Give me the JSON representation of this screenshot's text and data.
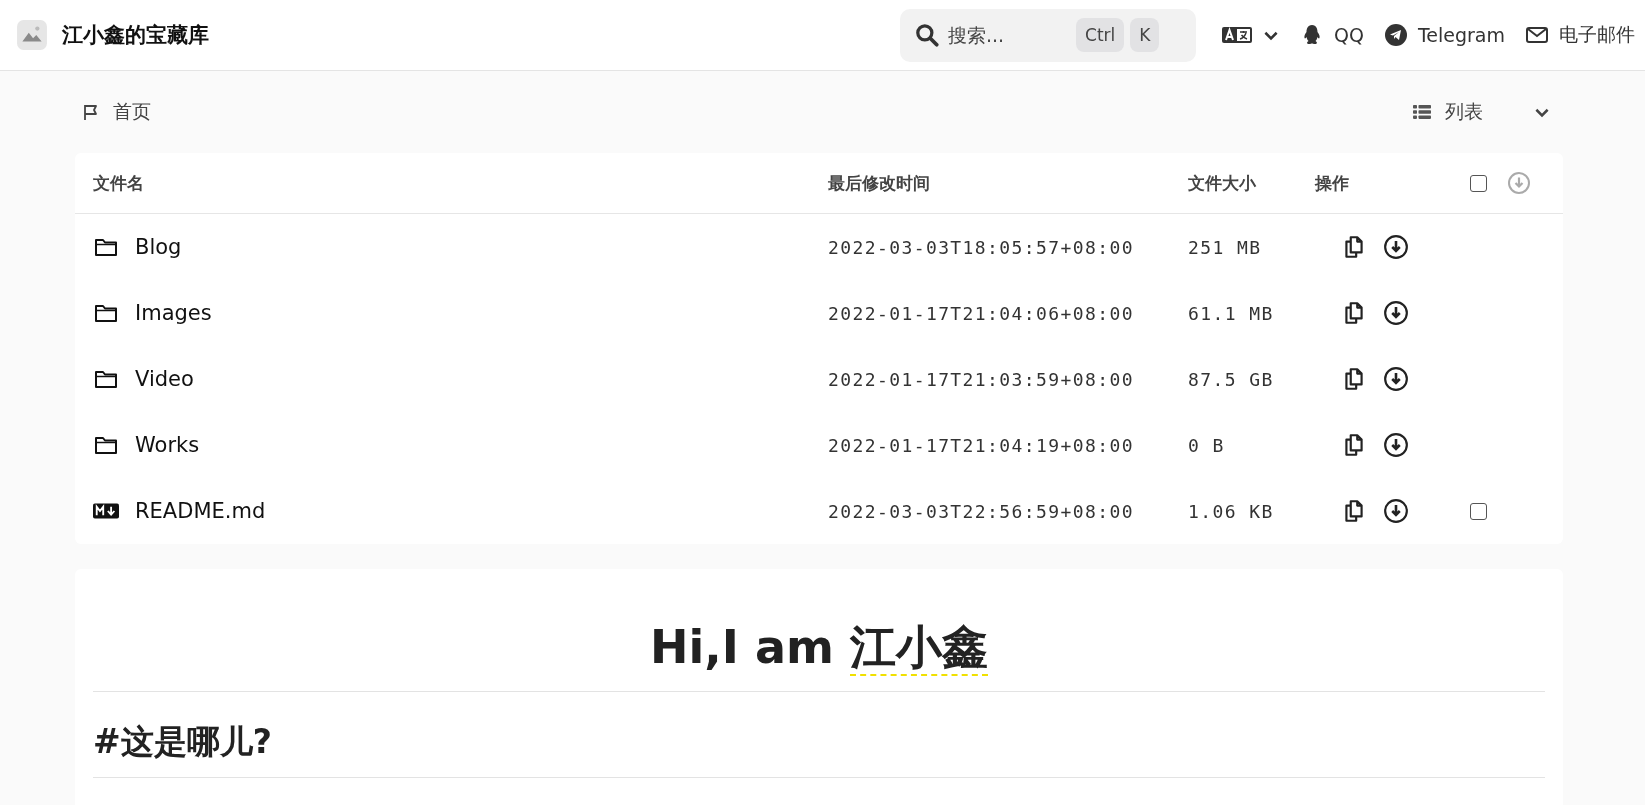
{
  "header": {
    "site_title": "江小鑫的宝藏库",
    "search": {
      "placeholder": "搜索...",
      "keys": [
        "Ctrl",
        "K"
      ]
    },
    "links": [
      {
        "kind": "qq",
        "label": "QQ"
      },
      {
        "kind": "telegram",
        "label": "Telegram"
      },
      {
        "kind": "email",
        "label": "电子邮件"
      }
    ]
  },
  "breadcrumb": {
    "label": "首页"
  },
  "view_switch": {
    "label": "列表",
    "expanded": false
  },
  "table": {
    "columns": [
      "文件名",
      "最后修改时间",
      "文件大小",
      "操作"
    ],
    "select_all": {
      "checked": false
    },
    "rows": [
      {
        "kind": "folder",
        "name": "Blog",
        "modified": "2022-03-03T18:05:57+08:00",
        "size": "251 MB"
      },
      {
        "kind": "folder",
        "name": "Images",
        "modified": "2022-01-17T21:04:06+08:00",
        "size": "61.1 MB"
      },
      {
        "kind": "folder",
        "name": "Video",
        "modified": "2022-01-17T21:03:59+08:00",
        "size": "87.5 GB"
      },
      {
        "kind": "folder",
        "name": "Works",
        "modified": "2022-01-17T21:04:19+08:00",
        "size": "0 B"
      },
      {
        "kind": "markdown",
        "name": "README.md",
        "modified": "2022-03-03T22:56:59+08:00",
        "size": "1.06 KB",
        "checked": false
      }
    ]
  },
  "readme": {
    "title": "Hi,I am ",
    "title_link": "江小鑫",
    "heading": "#这是哪儿?"
  }
}
